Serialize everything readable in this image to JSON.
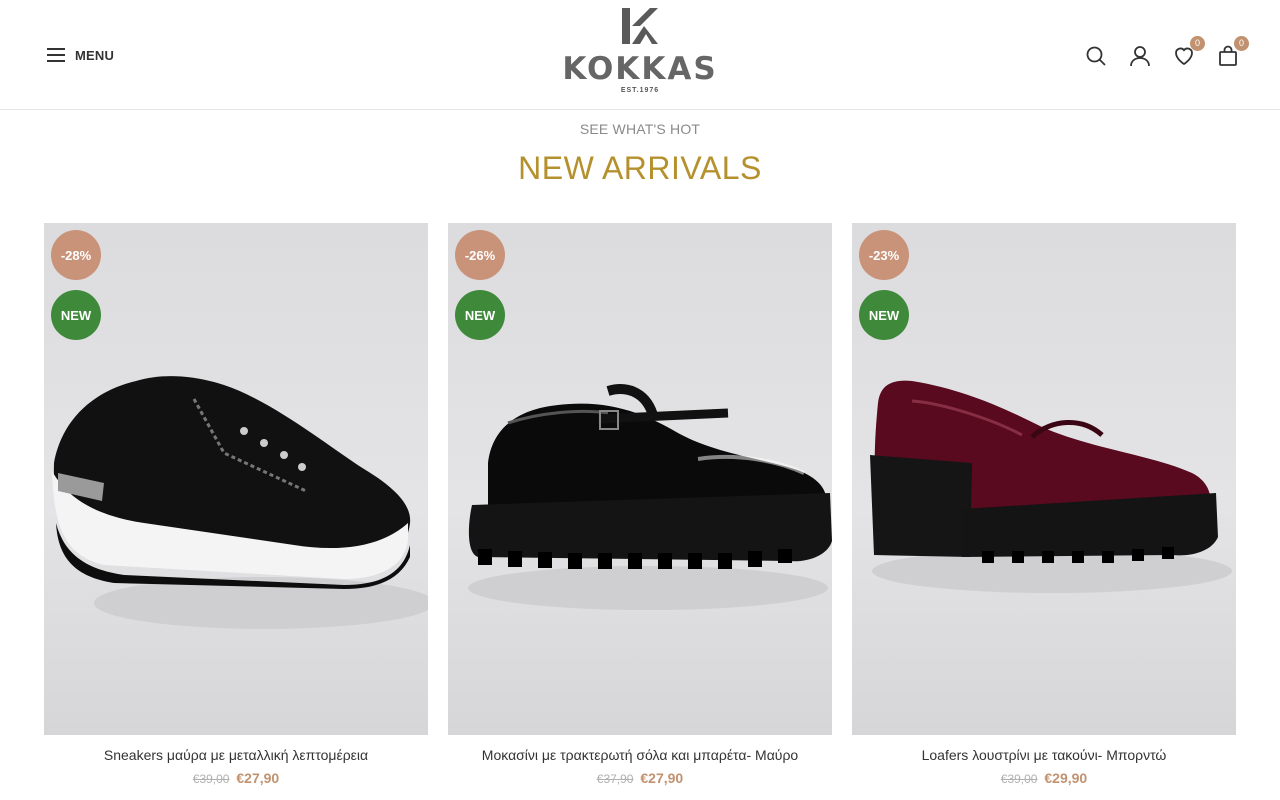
{
  "header": {
    "menu_label": "MENU",
    "logo_text": "KOKKAS",
    "logo_est": "EST.1976",
    "icons": [
      "search-icon",
      "user-icon",
      "wishlist-heart-icon",
      "cart-bag-icon"
    ],
    "wishlist_count": "0",
    "cart_count": "0"
  },
  "section": {
    "subtitle": "SEE WHAT'S HOT",
    "title": "NEW ARRIVALS"
  },
  "colors": {
    "accent_gold": "#b5912e",
    "price_color": "#c2916f",
    "discount_badge": "#c9937a",
    "new_badge": "#3e8a3a"
  },
  "products": [
    {
      "discount": "-28%",
      "label": "NEW",
      "name": "Sneakers μαύρα με μεταλλική λεπτομέρεια",
      "old_price": "€39,00",
      "price": "€27,90"
    },
    {
      "discount": "-26%",
      "label": "NEW",
      "name": "Μοκασίνι με τρακτερωτή σόλα και μπαρέτα- Μαύρο",
      "old_price": "€37,90",
      "price": "€27,90"
    },
    {
      "discount": "-23%",
      "label": "NEW",
      "name": "Loafers λουστρίνι με τακούνι- Μπορντώ",
      "old_price": "€39,00",
      "price": "€29,90"
    }
  ]
}
